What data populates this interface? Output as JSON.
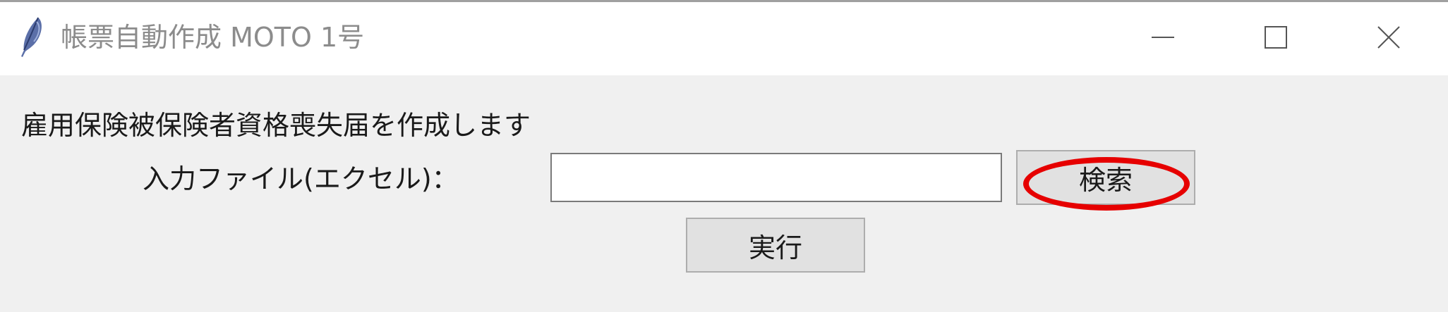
{
  "window": {
    "title": "帳票自動作成 MOTO 1号",
    "app_icon": "feather-icon",
    "controls": {
      "minimize_icon": "minimize-icon",
      "maximize_icon": "maximize-icon",
      "close_icon": "close-icon"
    }
  },
  "form": {
    "description": "雇用保険被保険者資格喪失届を作成します",
    "file_label": "入力ファイル(エクセル)：",
    "file_value": "",
    "file_placeholder": "",
    "search_button": "検索",
    "run_button": "実行"
  },
  "annotation": {
    "highlight_color": "#e60000",
    "highlight_target": "search-button"
  }
}
